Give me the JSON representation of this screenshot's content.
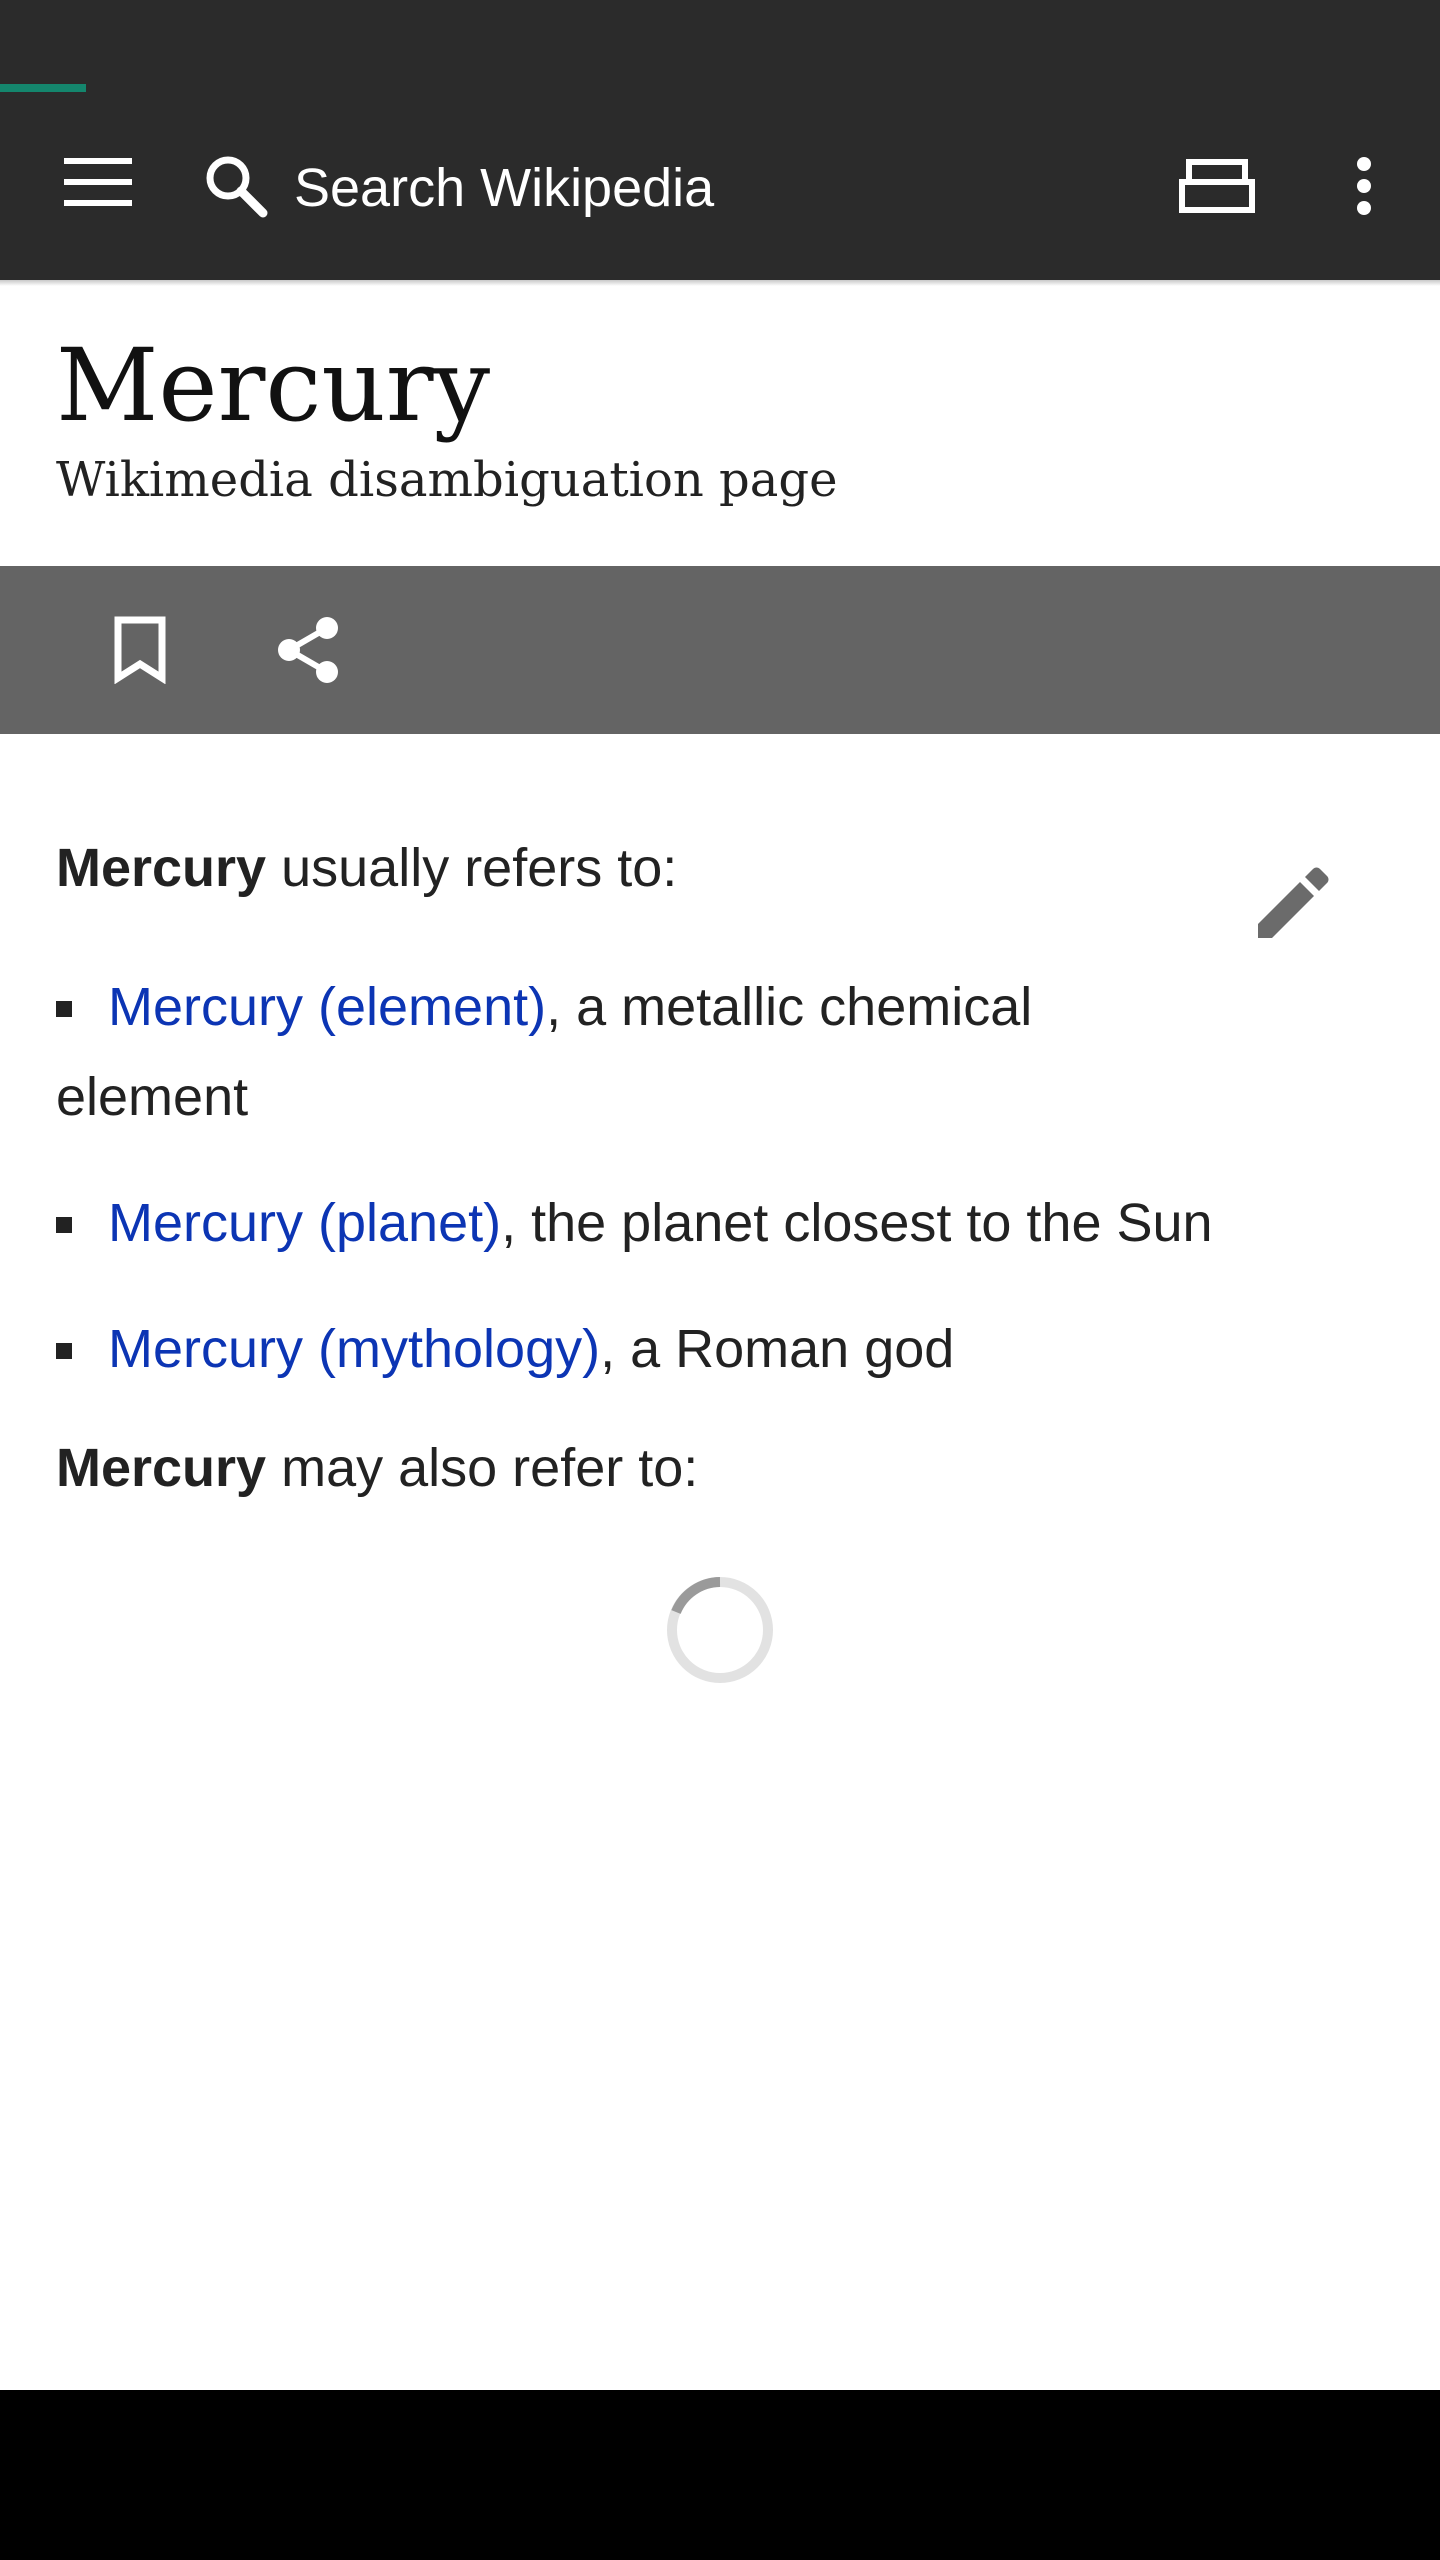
{
  "toolbar": {
    "search_placeholder": "Search Wikipedia",
    "menu_icon": "menu-icon",
    "search_icon": "search-icon",
    "tabs_icon": "tabs-icon",
    "overflow_icon": "more-vert-icon"
  },
  "load_progress": 0.06,
  "article": {
    "title": "Mercury",
    "description": "Wikimedia disambiguation page"
  },
  "actions": {
    "bookmark_icon": "bookmark-icon",
    "share_icon": "share-icon",
    "edit_icon": "edit-pencil-icon"
  },
  "content": {
    "intro_bold": "Mercury",
    "intro_rest": " usually refers to:",
    "entries": [
      {
        "link": "Mercury (element)",
        "text": ", a metallic chemical element"
      },
      {
        "link": "Mercury (planet)",
        "text": ", the planet closest to the Sun"
      },
      {
        "link": "Mercury (mythology)",
        "text": ", a Roman god"
      }
    ],
    "also_bold": "Mercury",
    "also_rest": " may also refer to:"
  },
  "colors": {
    "toolbar": "#2b2b2b",
    "action_bar": "#646464",
    "link": "#0c35b4",
    "progress": "#14866d"
  }
}
